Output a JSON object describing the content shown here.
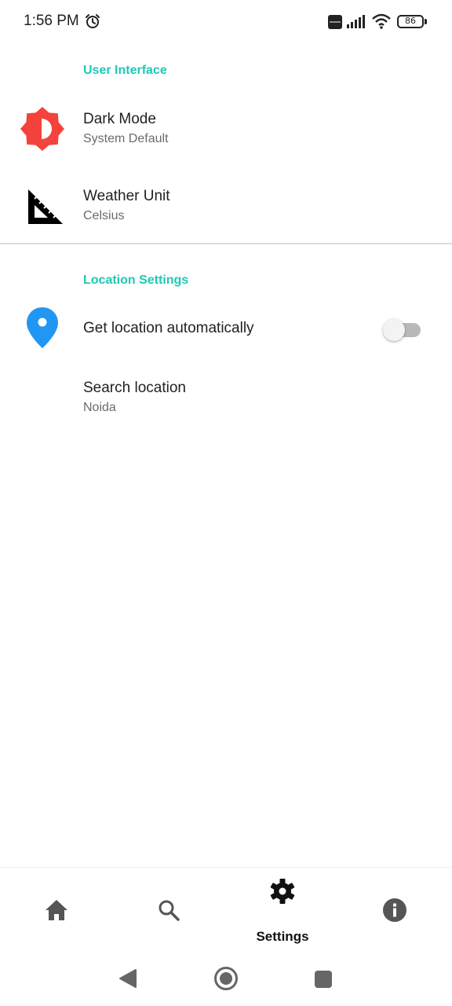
{
  "status_bar": {
    "time": "1:56 PM",
    "network_badge": "Vo LTE",
    "battery_level": "86",
    "icons": [
      "alarm-icon",
      "volte-icon",
      "signal-icon",
      "wifi-icon",
      "battery-icon"
    ]
  },
  "sections": {
    "user_interface": {
      "header": "User Interface",
      "dark_mode": {
        "title": "Dark Mode",
        "summary": "System Default",
        "icon": "brightness-icon"
      },
      "weather_unit": {
        "title": "Weather Unit",
        "summary": "Celsius",
        "icon": "set-square-ruler-icon"
      }
    },
    "location_settings": {
      "header": "Location Settings",
      "auto_location": {
        "title": "Get location automatically",
        "enabled": false,
        "icon": "location-pin-icon"
      },
      "search_location": {
        "title": "Search location",
        "summary": "Noida"
      }
    }
  },
  "bottom_nav": {
    "items": [
      {
        "icon": "home-icon",
        "label": ""
      },
      {
        "icon": "search-icon",
        "label": ""
      },
      {
        "icon": "gear-icon",
        "label": "Settings",
        "selected": true
      },
      {
        "icon": "info-icon",
        "label": ""
      }
    ]
  },
  "colors": {
    "accent": "#1dc9b7",
    "dark_mode_icon": "#f4433c",
    "location_icon": "#2196f3",
    "text_primary": "#212121",
    "text_secondary": "#6b6b6b"
  }
}
